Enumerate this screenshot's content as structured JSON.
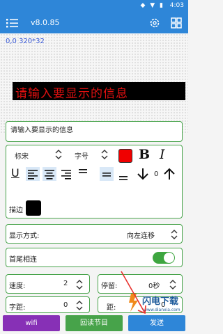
{
  "status_bar": {
    "time": "4:03"
  },
  "app_bar": {
    "version": "v8.0.85"
  },
  "preview": {
    "coordinates": "0,0 320*32",
    "led_text": "请输入要显示的信息"
  },
  "text_input": {
    "value": "请输入要显示的信息"
  },
  "font_panel": {
    "font_name": "标宋",
    "font_size_label": "字号",
    "text_color": "#f00000",
    "bold_label": "B",
    "italic_label": "I",
    "underline_label": "U",
    "spacing_value": "0",
    "stroke_label": "描边",
    "stroke_color": "#000000"
  },
  "display_mode": {
    "label": "显示方式:",
    "value": "向左连移"
  },
  "loop": {
    "label": "首尾相连",
    "enabled": true
  },
  "speed": {
    "label": "速度:",
    "value": "2"
  },
  "stay": {
    "label": "停留:",
    "value": "0秒"
  },
  "char_spacing": {
    "label": "字距:",
    "value": "0"
  },
  "line_spacing": {
    "label": "距:",
    "value": "0"
  },
  "buttons": {
    "wifi": "wifi",
    "read_program": "回读节目",
    "send": "发送"
  },
  "watermark": {
    "text": "闪电下载",
    "sub": "www.dianxia.com"
  }
}
